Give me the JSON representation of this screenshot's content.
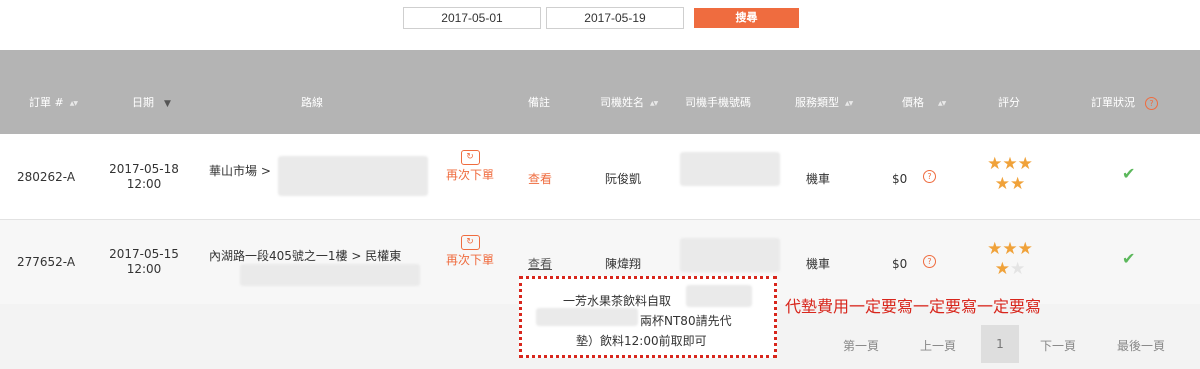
{
  "search": {
    "start_date": "2017-05-01",
    "end_date": "2017-05-19",
    "button_label": "搜尋"
  },
  "table": {
    "headers": {
      "order_no": "訂單 #",
      "date": "日期",
      "route": "路線",
      "note": "備註",
      "driver_name": "司機姓名",
      "driver_phone": "司機手機號碼",
      "service_type": "服務類型",
      "price": "價格",
      "rating": "評分",
      "order_status": "訂單狀況"
    },
    "rows": [
      {
        "order_no": "280262-A",
        "date": "2017-05-18",
        "time": "12:00",
        "route": "華山市場 >",
        "reorder_label": "再次下單",
        "note_link": "查看",
        "driver_name": "阮俊凱",
        "service_type": "機車",
        "price": "$0",
        "rating": 5,
        "status": "completed"
      },
      {
        "order_no": "277652-A",
        "date": "2017-05-15",
        "time": "12:00",
        "route": "內湖路一段405號之一1樓 > 民權東",
        "reorder_label": "再次下單",
        "note_link": "查看",
        "driver_name": "陳煒翔",
        "service_type": "機車",
        "price": "$0",
        "rating": 4,
        "status": "completed"
      }
    ]
  },
  "note_popup": {
    "line1": "一芳水果茶飲料自取",
    "line2": "兩杯NT80請先代",
    "line3": "墊）飲料12:00前取即可"
  },
  "annotation": "代墊費用一定要寫一定要寫一定要寫",
  "pagination": {
    "first": "第一頁",
    "prev": "上一頁",
    "current": "1",
    "next": "下一頁",
    "last": "最後一頁"
  },
  "icons": {
    "sort": "sort-updown-icon",
    "sort_desc": "caret-down-icon",
    "help": "question-circle-icon",
    "reorder": "refresh-icon",
    "star": "star-icon",
    "check": "check-icon"
  },
  "colors": {
    "accent": "#ef6c3f",
    "header_bg": "#b4b4b4",
    "check": "#5cb85c",
    "star": "#f0a23a",
    "annotation": "#d8261c"
  }
}
